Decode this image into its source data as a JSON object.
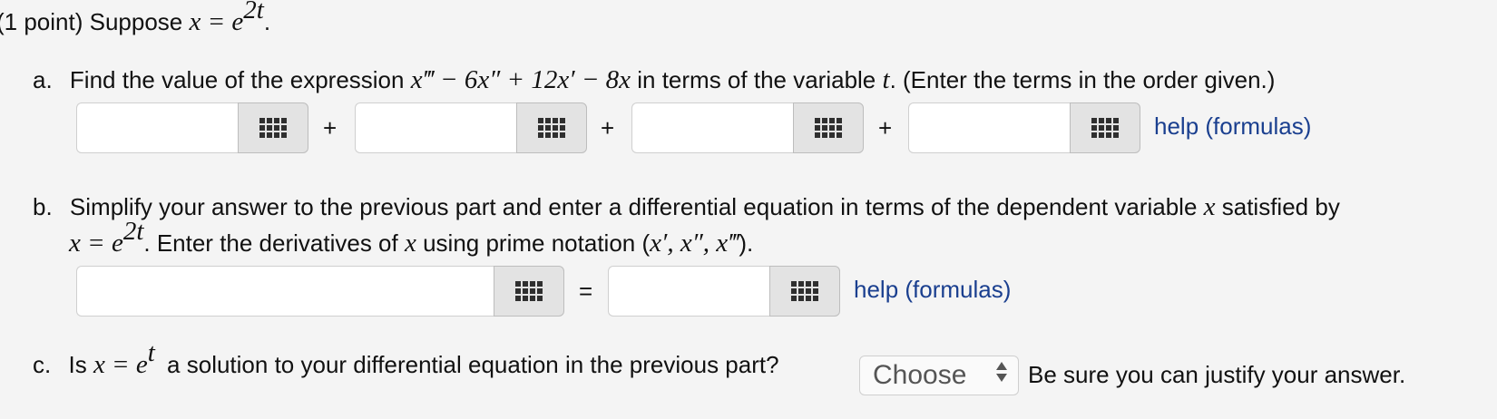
{
  "header": {
    "label": "(1 point) Suppose",
    "eq": "x = e",
    "exp": "2t",
    "tail": "."
  },
  "part_a": {
    "marker": "a.",
    "text1": "Find the value of the expression",
    "expr": "x‴ − 6x″ + 12x′ − 8x",
    "text2": "in terms of the variable",
    "var": "t",
    "text3": ". (Enter the terms in the order given.)",
    "plus": "+",
    "fields": [
      "",
      "",
      "",
      ""
    ],
    "help_link": "help (formulas)"
  },
  "part_b": {
    "marker": "b.",
    "text1": "Simplify your answer to the previous part and enter a differential equation in terms of the dependent variable",
    "var": "x",
    "text2": "satisfied by",
    "eq": "x = e",
    "exp": "2t",
    "text3": ". Enter the derivatives of",
    "var2": "x",
    "text4": "using prime notation (",
    "primes": "x′, x″, x‴",
    "text5": ").",
    "equals": "=",
    "left_field": "",
    "right_field": "",
    "help_link": "help (formulas)"
  },
  "part_c": {
    "marker": "c.",
    "text1": "Is",
    "eq": "x = e",
    "exp": "t",
    "text2": "a solution to your differential equation in the previous part?",
    "select_value": "Choose",
    "text3": "Be sure you can justify your answer."
  }
}
